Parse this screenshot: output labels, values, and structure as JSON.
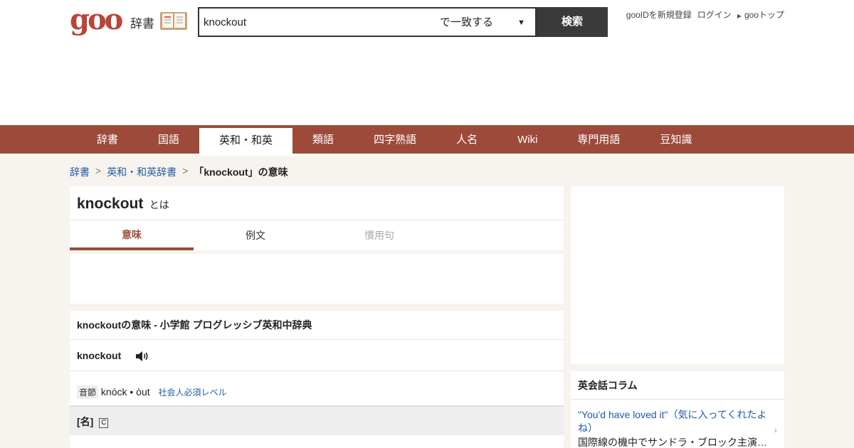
{
  "header": {
    "logo": "goo",
    "logo_sub": "辞書",
    "search_value": "knockout",
    "match_mode": "で一致する",
    "search_button": "検索",
    "links": [
      "gooIDを新規登録",
      "ログイン",
      "gooトップ"
    ]
  },
  "nav": {
    "items": [
      "辞書",
      "国語",
      "英和・和英",
      "類語",
      "四字熟語",
      "人名",
      "Wiki",
      "専門用語",
      "豆知識"
    ],
    "active": "英和・和英"
  },
  "breadcrumb": {
    "items": [
      "辞書",
      "英和・和英辞書",
      "「knockout」の意味"
    ],
    "separator": ">"
  },
  "main": {
    "title_word": "knockout",
    "title_suffix": "とは",
    "tabs": [
      "意味",
      "例文",
      "慣用句"
    ],
    "dict_heading": "knockoutの意味 - 小学館 プログレッシブ英和中辞典",
    "entry_word": "knockout",
    "pron_badge": "音節",
    "pronunciation": "knóck • òut",
    "level": "社会人必須レベル",
    "pos": "[名]",
    "count_badge": "C"
  },
  "sidebar": {
    "column_heading": "英会話コラム",
    "column_link": "\"You'd have loved it\"（気に入ってくれたよね）",
    "column_desc": "国際線の機中でサンドラ・ブロック主演…"
  },
  "colors": {
    "brand": "#9e4a3a",
    "logo": "#b8453a",
    "link": "#1f5aa6"
  }
}
